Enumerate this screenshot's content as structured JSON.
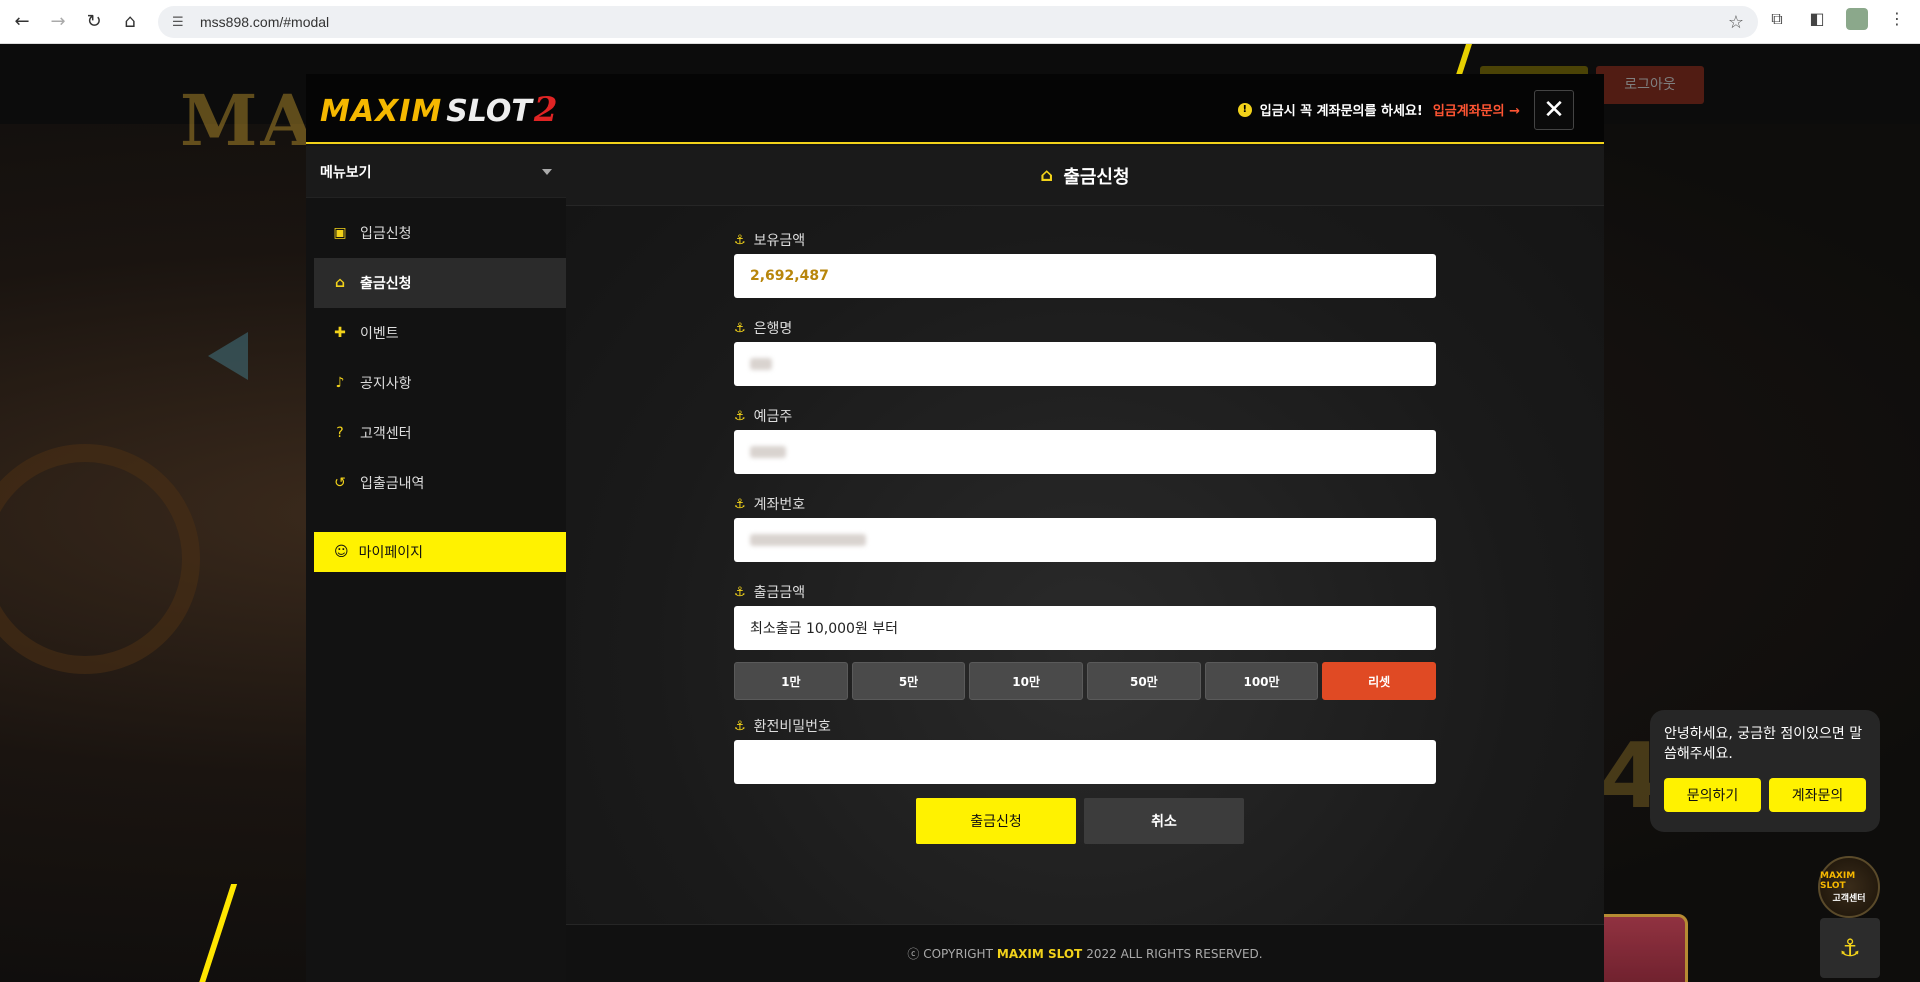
{
  "browser": {
    "url": "mss898.com/#modal"
  },
  "background": {
    "logo_text": "MAXIM SL",
    "logout_label": "로그아웃",
    "big_number": "4"
  },
  "modal": {
    "logo": {
      "maxim": "MAXIM",
      "slot": "SLOT",
      "num": "2"
    },
    "notice": {
      "message": "입금시 꼭 계좌문의를 하세요!",
      "link": "입금계좌문의 →"
    },
    "close_label": "✕"
  },
  "sidebar": {
    "toggle_label": "메뉴보기",
    "items": [
      {
        "label": "입금신청",
        "icon": "money-icon",
        "active": false
      },
      {
        "label": "출금신청",
        "icon": "bank-icon",
        "active": true
      },
      {
        "label": "이벤트",
        "icon": "gift-icon",
        "active": false
      },
      {
        "label": "공지사항",
        "icon": "bell-icon",
        "active": false
      },
      {
        "label": "고객센터",
        "icon": "help-icon",
        "active": false
      },
      {
        "label": "입출금내역",
        "icon": "history-icon",
        "active": false
      }
    ],
    "mypage_label": "마이페이지"
  },
  "page": {
    "title": "출금신청"
  },
  "form": {
    "balance_label": "보유금액",
    "balance_value": "2,692,487",
    "bank_label": "은행명",
    "holder_label": "예금주",
    "account_label": "계좌번호",
    "amount_label": "출금금액",
    "amount_placeholder": "최소출금 10,000원 부터",
    "amount_buttons": [
      "1만",
      "5만",
      "10만",
      "50만",
      "100만",
      "리셋"
    ],
    "password_label": "환전비밀번호"
  },
  "actions": {
    "submit_label": "출금신청",
    "cancel_label": "취소"
  },
  "footer": {
    "prefix": "ⓒ COPYRIGHT",
    "brand": "MAXIM SLOT",
    "suffix": "2022 ALL RIGHTS RESERVED."
  },
  "chat": {
    "message": "안녕하세요, 궁금한 점이있으면 말씀해주세요.",
    "inquiry_label": "문의하기",
    "account_inquiry_label": "계좌문의",
    "badge_brand": "MAXIM SLOT",
    "badge_label": "고객센터"
  },
  "colors": {
    "accent": "#fff200",
    "reset": "#e04a24",
    "link": "#ff5533"
  }
}
